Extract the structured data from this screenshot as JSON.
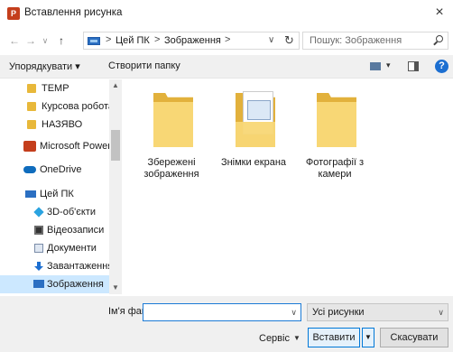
{
  "window": {
    "title": "Вставлення рисунка",
    "close_symbol": "×"
  },
  "nav": {
    "back": "←",
    "forward": "→",
    "history": "∨",
    "up": "↑",
    "breadcrumb": [
      "Цей ПК",
      "Зображення"
    ],
    "separator": ">",
    "dropdown": "∨",
    "refresh": "↻",
    "search_placeholder": "Пошук: Зображення"
  },
  "toolbar": {
    "organize": "Упорядкувати ▾",
    "new_folder": "Створити папку",
    "view_dropdown": "▾",
    "help": "?"
  },
  "sidebar": {
    "items": [
      {
        "label": "TEMP",
        "icon": "folder-icon"
      },
      {
        "label": "Курсова робота",
        "icon": "folder-icon"
      },
      {
        "label": "НАЗЯВО",
        "icon": "folder-icon"
      },
      {
        "label": "Microsoft PowerPoint",
        "icon": "powerpoint-icon"
      },
      {
        "label": "OneDrive",
        "icon": "onedrive-icon"
      },
      {
        "label": "Цей ПК",
        "icon": "this-pc-icon"
      },
      {
        "label": "3D-об'єкти",
        "icon": "3d-objects-icon"
      },
      {
        "label": "Відеозаписи",
        "icon": "videos-icon"
      },
      {
        "label": "Документи",
        "icon": "documents-icon"
      },
      {
        "label": "Завантаження",
        "icon": "downloads-icon"
      },
      {
        "label": "Зображення",
        "icon": "pictures-icon"
      }
    ],
    "selected_index": 10,
    "scroll_up": "▲",
    "scroll_down": "▼"
  },
  "content": {
    "folders": [
      {
        "label": "Збережені зображення"
      },
      {
        "label": "Знімки екрана"
      },
      {
        "label": "Фотографії з камери"
      }
    ]
  },
  "footer": {
    "filename_label": "Ім'я файлу:",
    "filename_value": "",
    "filename_dropdown": "∨",
    "filter_value": "Усі рисунки",
    "filter_dropdown": "∨",
    "tools_label": "Сервіс",
    "tools_dropdown": "▼",
    "insert_label": "Вставити",
    "insert_dropdown": "▼",
    "cancel_label": "Скасувати"
  }
}
